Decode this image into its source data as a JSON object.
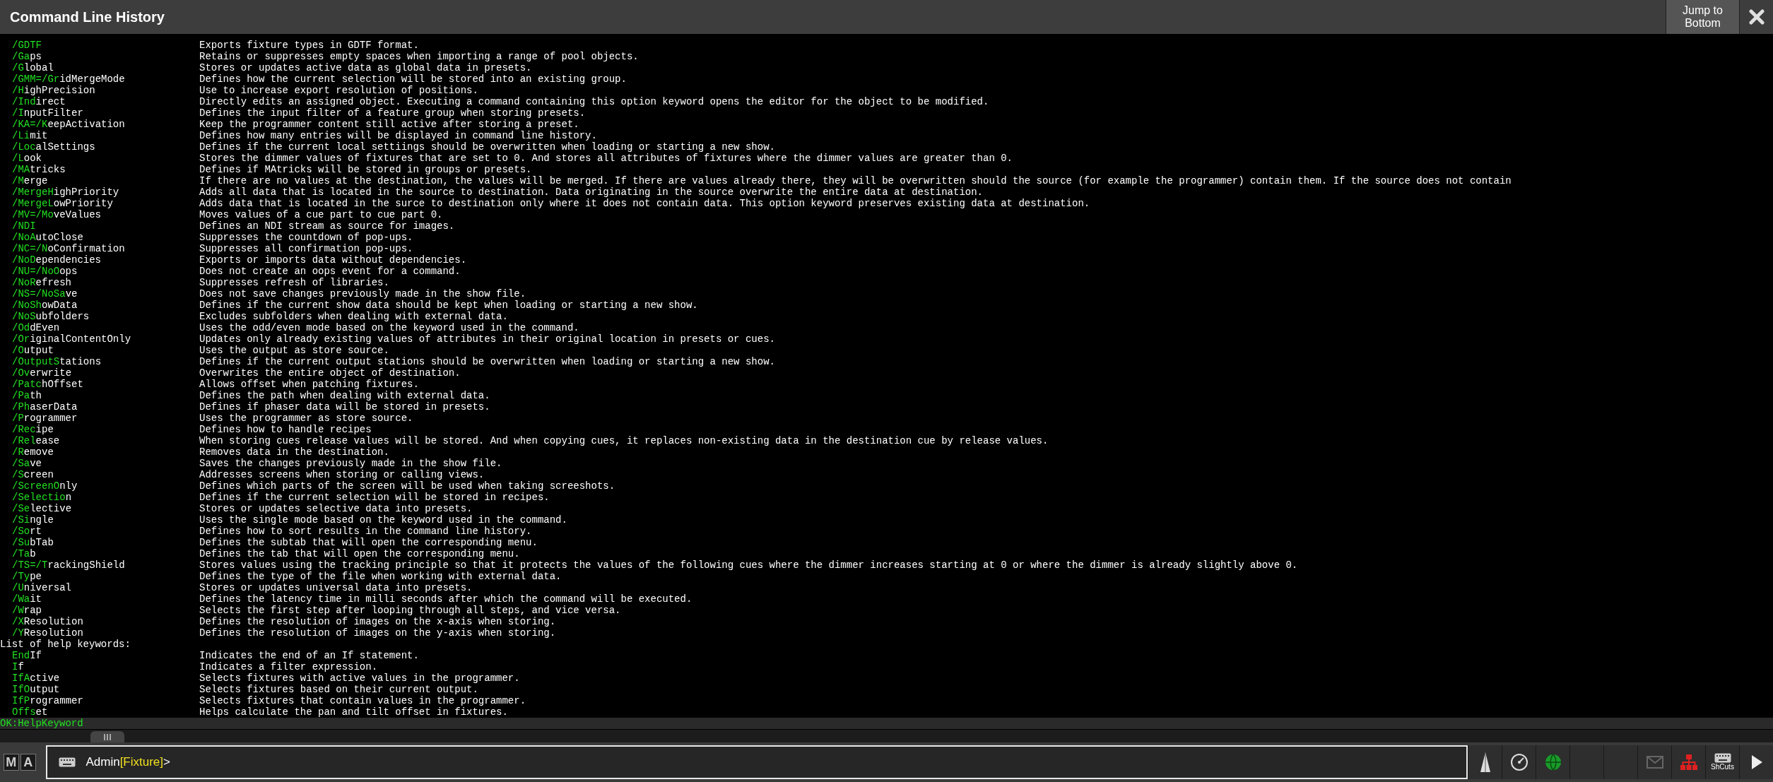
{
  "window": {
    "title": "Command Line History"
  },
  "jump_button": "Jump to Bottom",
  "lines": [
    {
      "kind": "entry",
      "key": "/GDTF",
      "description": "Exports fixture types in GDTF format."
    },
    {
      "kind": "entry",
      "key": "/Ga",
      "rest": "ps",
      "description": "Retains or suppresses empty spaces when importing a range of pool objects."
    },
    {
      "kind": "entry",
      "key": "/G",
      "rest": "lobal",
      "description": "Stores or updates active data as global data in presets."
    },
    {
      "kind": "entry",
      "key": "/GMM=/Gr",
      "rest": "idMergeMode",
      "description": "Defines how the current selection will be stored into an existing group."
    },
    {
      "kind": "entry",
      "key": "/H",
      "rest": "ighPrecision",
      "description": "Use to increase export resolution of positions."
    },
    {
      "kind": "entry",
      "key": "/Ind",
      "rest": "irect",
      "description": "Directly edits an assigned object. Executing a command containing this option keyword opens the editor for the object to be modified."
    },
    {
      "kind": "entry",
      "key": "/I",
      "rest": "nputFilter",
      "description": "Defines the input filter of a feature group when storing presets."
    },
    {
      "kind": "entry",
      "key": "/KA=/K",
      "rest": "eepActivation",
      "description": "Keep the programmer content still active after storing a preset."
    },
    {
      "kind": "entry",
      "key": "/Li",
      "rest": "mit",
      "description": "Defines how many entries will be displayed in command line history."
    },
    {
      "kind": "entry",
      "key": "/Loc",
      "rest": "alSettings",
      "description": "Defines if the current local settiings should be overwritten when loading or starting a new show."
    },
    {
      "kind": "entry",
      "key": "/L",
      "rest": "ook",
      "description": "Stores the dimmer values of fixtures that are set to 0. And stores all attributes of fixtures where the dimmer values are greater than 0."
    },
    {
      "kind": "entry",
      "key": "/MA",
      "rest": "tricks",
      "description": "Defines if MAtricks will be stored in groups or presets."
    },
    {
      "kind": "entry",
      "key": "/M",
      "rest": "erge",
      "description": "If there are no values at the destination, the values will be merged. If there are values already there, they will be overwritten should the source (for example the programmer) contain them. If the source does not contain"
    },
    {
      "kind": "entry",
      "key": "/MergeH",
      "rest": "ighPriority",
      "description": "Adds all data that is located in the source to destination. Data originating in the source overwrite the entire data at destination."
    },
    {
      "kind": "entry",
      "key": "/MergeL",
      "rest": "owPriority",
      "description": "Adds data that is located in the surce to destination only where it does not contain data. This option keyword preserves existing data at destination."
    },
    {
      "kind": "entry",
      "key": "/MV=/Mo",
      "rest": "veValues",
      "description": "Moves values of a cue part to cue part 0."
    },
    {
      "kind": "entry",
      "key": "/NDI",
      "description": "Defines an NDI stream as source for images."
    },
    {
      "kind": "entry",
      "key": "/NoA",
      "rest": "utoClose",
      "description": "Suppresses the countdown of pop-ups."
    },
    {
      "kind": "entry",
      "key": "/NC=/N",
      "rest": "oConfirmation",
      "description": "Suppresses all confirmation pop-ups."
    },
    {
      "kind": "entry",
      "key": "/NoD",
      "rest": "ependencies",
      "description": "Exports or imports data without dependencies."
    },
    {
      "kind": "entry",
      "key": "/NU=/NoO",
      "rest": "ops",
      "description": "Does not create an oops event for a command."
    },
    {
      "kind": "entry",
      "key": "/NoR",
      "rest": "efresh",
      "description": "Suppresses refresh of libraries."
    },
    {
      "kind": "entry",
      "key": "/NS=/NoSa",
      "rest": "ve",
      "description": "Does not save changes previously made in the show file."
    },
    {
      "kind": "entry",
      "key": "/NoSh",
      "rest": "owData",
      "description": "Defines if the current show data should be kept when loading or starting a new show."
    },
    {
      "kind": "entry",
      "key": "/NoS",
      "rest": "ubfolders",
      "description": "Excludes subfolders when dealing with external data."
    },
    {
      "kind": "entry",
      "key": "/Od",
      "rest": "dEven",
      "description": "Uses the odd/even mode based on the keyword used in the command."
    },
    {
      "kind": "entry",
      "key": "/Or",
      "rest": "iginalContentOnly",
      "description": "Updates only already existing values of attributes in their original location in presets or cues."
    },
    {
      "kind": "entry",
      "key": "/O",
      "rest": "utput",
      "description": "Uses the output as store source."
    },
    {
      "kind": "entry",
      "key": "/OutputS",
      "rest": "tations",
      "description": "Defines if the current output stations should be overwritten when loading or starting a new show."
    },
    {
      "kind": "entry",
      "key": "/Ov",
      "rest": "erwrite",
      "description": "Overwrites the entire object of destination."
    },
    {
      "kind": "entry",
      "key": "/Patc",
      "rest": "hOffset",
      "description": "Allows offset when patching fixtures."
    },
    {
      "kind": "entry",
      "key": "/Pa",
      "rest": "th",
      "description": "Defines the path when dealing with external data."
    },
    {
      "kind": "entry",
      "key": "/Ph",
      "rest": "aserData",
      "description": "Defines if phaser data will be stored in presets."
    },
    {
      "kind": "entry",
      "key": "/P",
      "rest": "rogrammer",
      "description": "Uses the programmer as store source."
    },
    {
      "kind": "entry",
      "key": "/Rec",
      "rest": "ipe",
      "description": "Defines how to handle recipes"
    },
    {
      "kind": "entry",
      "key": "/Rel",
      "rest": "ease",
      "description": "When storing cues release values will be stored. And when copying cues, it replaces non-existing data in the destination cue by release values."
    },
    {
      "kind": "entry",
      "key": "/R",
      "rest": "emove",
      "description": "Removes data in the destination."
    },
    {
      "kind": "entry",
      "key": "/Sa",
      "rest": "ve",
      "description": "Saves the changes previously made in the show file."
    },
    {
      "kind": "entry",
      "key": "/S",
      "rest": "creen",
      "description": "Addresses screens when storing or calling views."
    },
    {
      "kind": "entry",
      "key": "/ScreenO",
      "rest": "nly",
      "description": "Defines which parts of the screen will be used when taking screeshots."
    },
    {
      "kind": "entry",
      "key": "/Selectio",
      "rest": "n",
      "description": "Defines if the current selection will be stored in recipes."
    },
    {
      "kind": "entry",
      "key": "/Se",
      "rest": "lective",
      "description": "Stores or updates selective data into presets."
    },
    {
      "kind": "entry",
      "key": "/Si",
      "rest": "ngle",
      "description": "Uses the single mode based on the keyword used in the command."
    },
    {
      "kind": "entry",
      "key": "/So",
      "rest": "rt",
      "description": "Defines how to sort results in the command line history."
    },
    {
      "kind": "entry",
      "key": "/Su",
      "rest": "bTab",
      "description": "Defines the subtab that will open the corresponding menu."
    },
    {
      "kind": "entry",
      "key": "/Ta",
      "rest": "b",
      "description": "Defines the tab that will open the corresponding menu."
    },
    {
      "kind": "entry",
      "key": "/TS=/T",
      "rest": "rackingShield",
      "description": "Stores values using the tracking principle so that it protects the values of the following cues where the dimmer increases starting at 0 or where the dimmer is already slightly above 0."
    },
    {
      "kind": "entry",
      "key": "/Ty",
      "rest": "pe",
      "description": "Defines the type of the file when working with external data."
    },
    {
      "kind": "entry",
      "key": "/U",
      "rest": "niversal",
      "description": "Stores or updates universal data into presets."
    },
    {
      "kind": "entry",
      "key": "/Wa",
      "rest": "it",
      "description": "Defines the latency time in milli seconds after which the command will be executed."
    },
    {
      "kind": "entry",
      "key": "/W",
      "rest": "rap",
      "description": "Selects the first step after looping through all steps, and vice versa."
    },
    {
      "kind": "entry",
      "key": "/X",
      "rest": "Resolution",
      "description": "Defines the resolution of images on the x-axis when storing."
    },
    {
      "kind": "entry",
      "key": "/Y",
      "rest": "Resolution",
      "description": "Defines the resolution of images on the y-axis when storing."
    },
    {
      "kind": "heading",
      "text": "List of help keywords:"
    },
    {
      "kind": "entry",
      "key": "End",
      "rest": "If",
      "description": "Indicates the end of an If statement."
    },
    {
      "kind": "entry",
      "key": "I",
      "rest": "f",
      "description": "Indicates a filter expression."
    },
    {
      "kind": "entry",
      "key": "IfA",
      "rest": "ctive",
      "description": "Selects fixtures with active values in the programmer."
    },
    {
      "kind": "entry",
      "key": "IfO",
      "rest": "utput",
      "description": "Selects fixtures based on their current output."
    },
    {
      "kind": "entry",
      "key": "IfP",
      "rest": "rogrammer",
      "description": "Selects fixtures that contain values in the programmer."
    },
    {
      "kind": "entry",
      "key": "Offs",
      "rest": "et",
      "description": "Helps calculate the pan and tilt offset in fixtures."
    }
  ],
  "status_line": "OK:HelpKeyword",
  "command_line": {
    "user": "Admin",
    "context": "[Fixture]",
    "prompt": ">"
  },
  "logo": [
    "M",
    "A"
  ],
  "shortcuts_label": "ShCuts"
}
